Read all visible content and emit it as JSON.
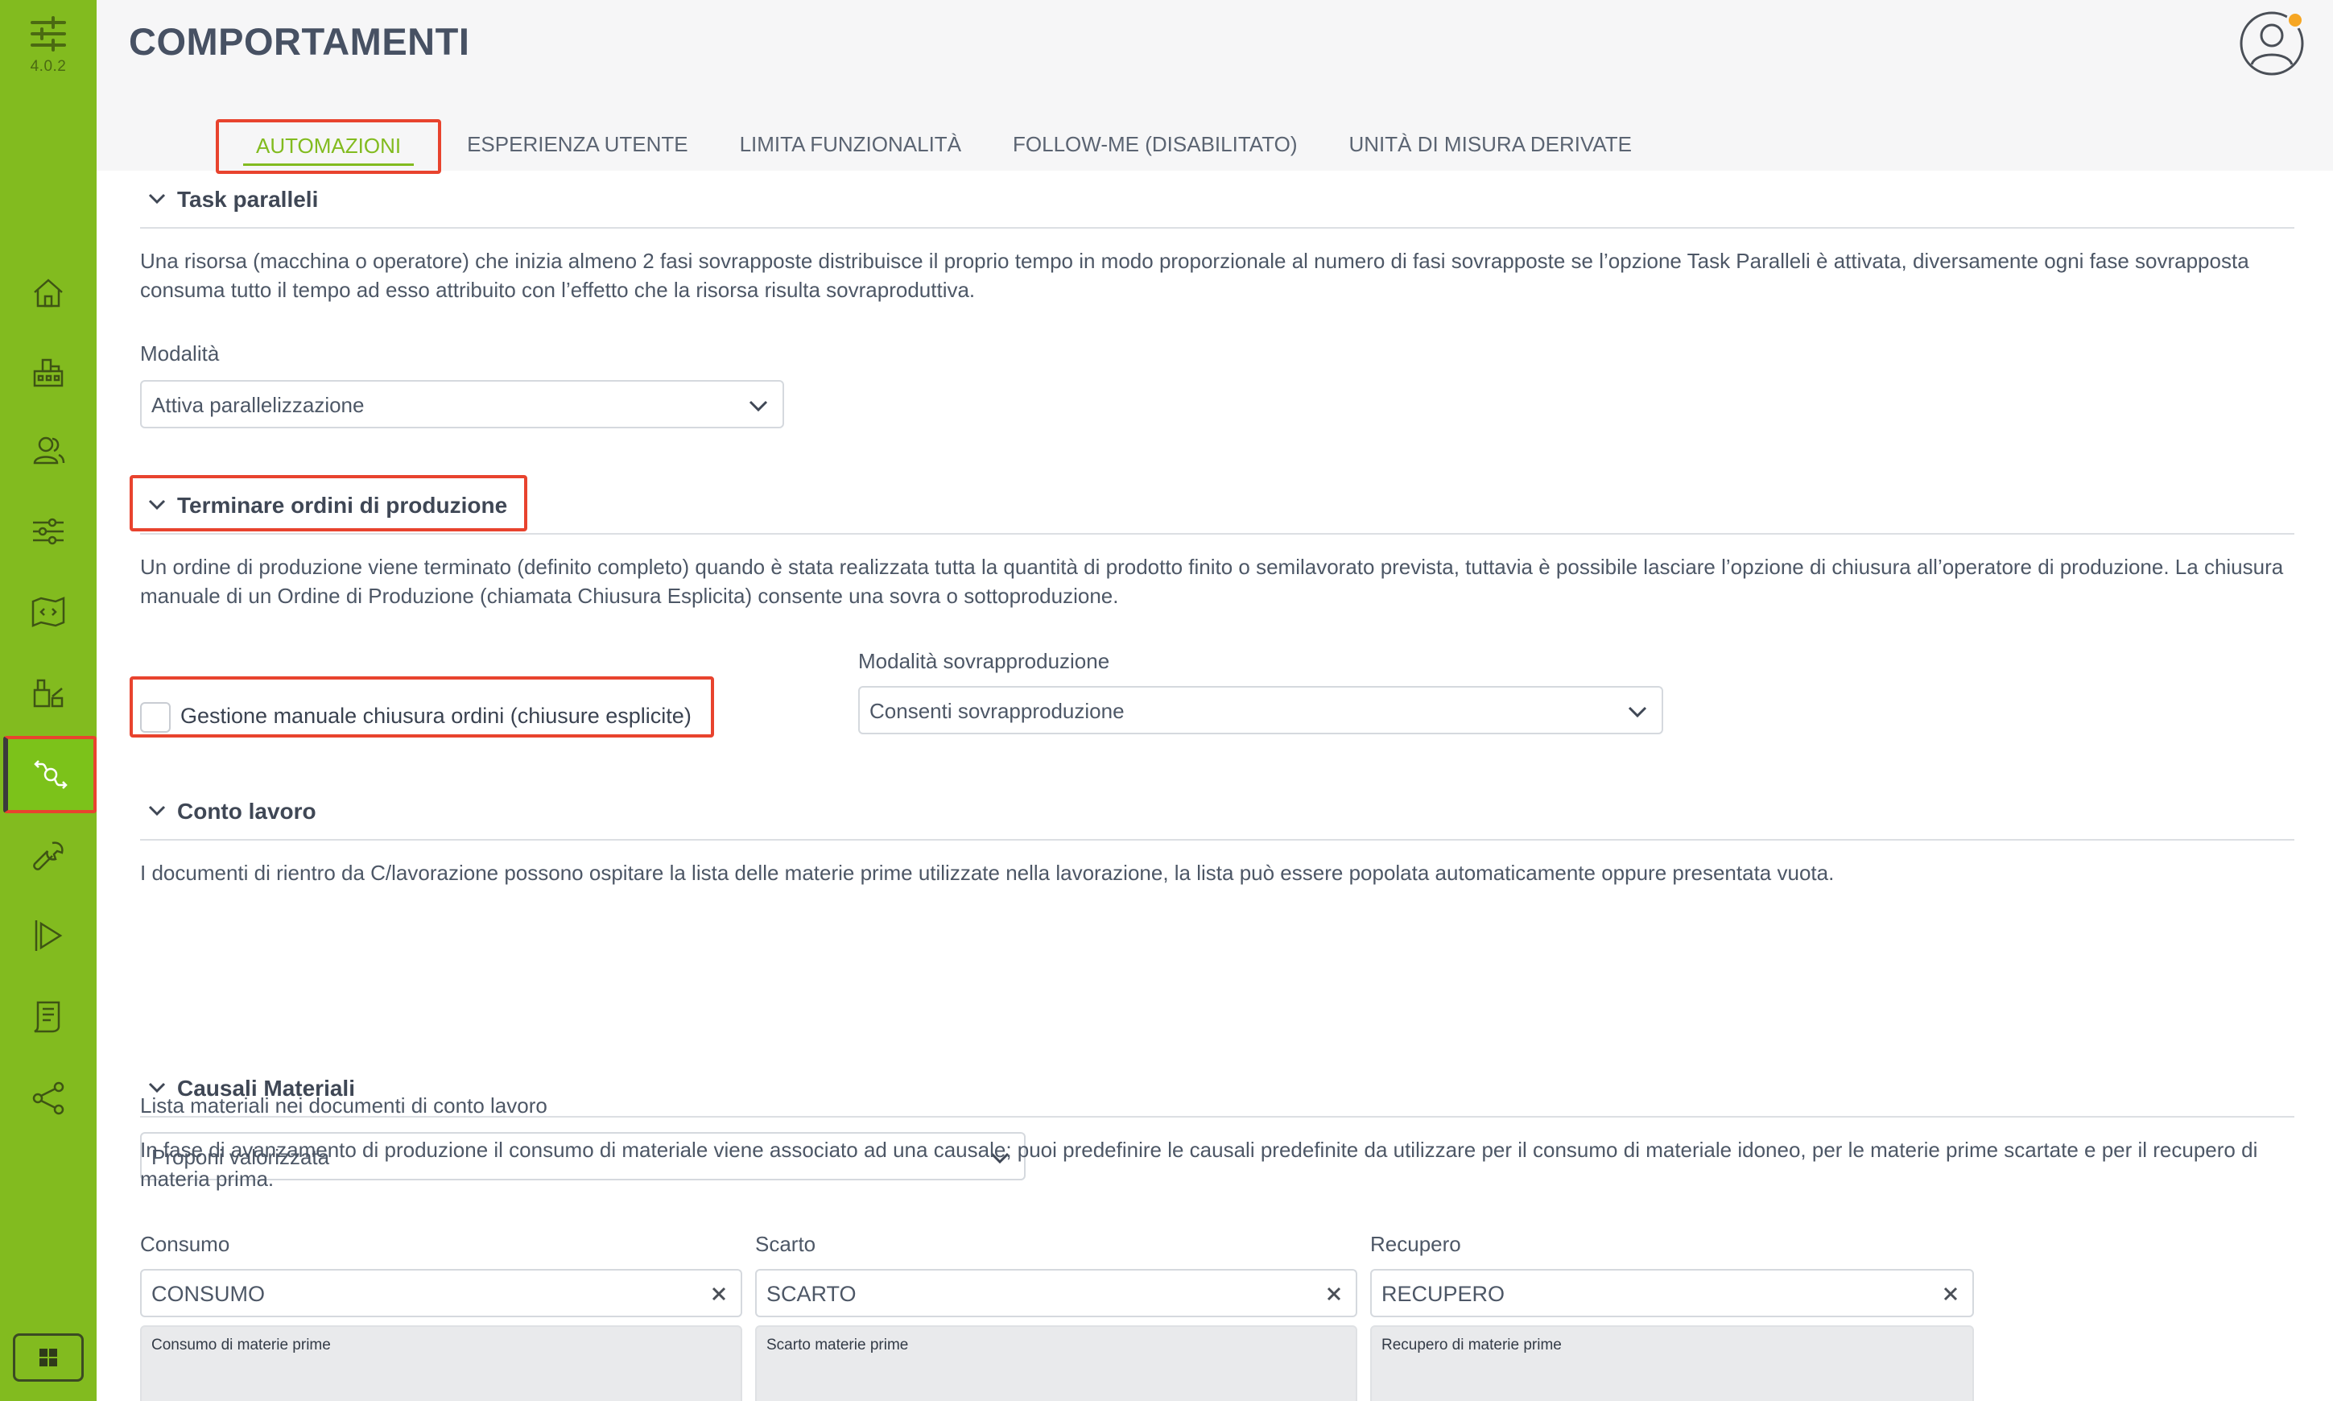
{
  "app": {
    "version": "4.0.2",
    "accent": "#82bb1f",
    "highlight": "#e8432e"
  },
  "sidebar": {
    "items": [
      {
        "icon": "home-icon"
      },
      {
        "icon": "factory-icon"
      },
      {
        "icon": "users-icon"
      },
      {
        "icon": "sliders-icon"
      },
      {
        "icon": "code-map-icon"
      },
      {
        "icon": "machine-icon"
      },
      {
        "icon": "behaviors-icon",
        "active": true
      },
      {
        "icon": "wrench-icon"
      },
      {
        "icon": "play-flag-icon"
      },
      {
        "icon": "document-icon"
      },
      {
        "icon": "share-icon"
      }
    ],
    "bottom_icon": "grid-icon"
  },
  "header": {
    "title": "COMPORTAMENTI"
  },
  "tabs": [
    {
      "label": "AUTOMAZIONI",
      "active": true
    },
    {
      "label": "ESPERIENZA UTENTE"
    },
    {
      "label": "LIMITA FUNZIONALITÀ"
    },
    {
      "label": "FOLLOW-ME (DISABILITATO)"
    },
    {
      "label": "UNITÀ DI MISURA DERIVATE"
    }
  ],
  "sections": {
    "task_paralleli": {
      "title": "Task paralleli",
      "description": "Una risorsa (macchina o operatore) che inizia almeno 2 fasi sovrapposte distribuisce il proprio tempo in modo proporzionale al numero di fasi sovrapposte se l’opzione Task Paralleli è attivata, diversamente ogni fase sovrapposta consuma tutto il tempo ad esso attribuito con l’effetto che la risorsa risulta sovraproduttiva.",
      "field_label": "Modalità",
      "field_value": "Attiva parallelizzazione"
    },
    "terminare_ordini": {
      "title": "Terminare ordini di produzione",
      "description": "Un ordine di produzione viene terminato (definito completo) quando è stata realizzata tutta la quantità di prodotto finito o semilavorato prevista, tuttavia è possibile lasciare l’opzione di chiusura all’operatore di produzione. La chiusura manuale di un Ordine di Produzione (chiamata Chiusura Esplicita) consente una sovra o sottoproduzione.",
      "checkbox_label": "Gestione manuale chiusura ordini (chiusure esplicite)",
      "checkbox_checked": false,
      "field_label": "Modalità sovrapproduzione",
      "field_value": "Consenti sovrapproduzione"
    },
    "conto_lavoro": {
      "title": "Conto lavoro",
      "description": "I documenti di rientro da C/lavorazione possono ospitare la lista delle materie prime utilizzate nella lavorazione, la lista può essere popolata automaticamente oppure presentata vuota.",
      "field_label": "Lista materiali nei documenti di conto lavoro",
      "field_value": "Proponi valorizzata"
    },
    "causali_materiali": {
      "title": "Causali Materiali",
      "description": "In fase di avanzamento di produzione il consumo di materiale viene associato ad una causale; puoi predefinire le causali predefinite da utilizzare per il consumo di materiale idoneo, per le materie prime scartate e per il recupero di materia prima.",
      "fields": [
        {
          "label": "Consumo",
          "value": "CONSUMO",
          "description": "Consumo di materie prime"
        },
        {
          "label": "Scarto",
          "value": "SCARTO",
          "description": "Scarto materie prime"
        },
        {
          "label": "Recupero",
          "value": "RECUPERO",
          "description": "Recupero di materie prime"
        }
      ]
    }
  }
}
